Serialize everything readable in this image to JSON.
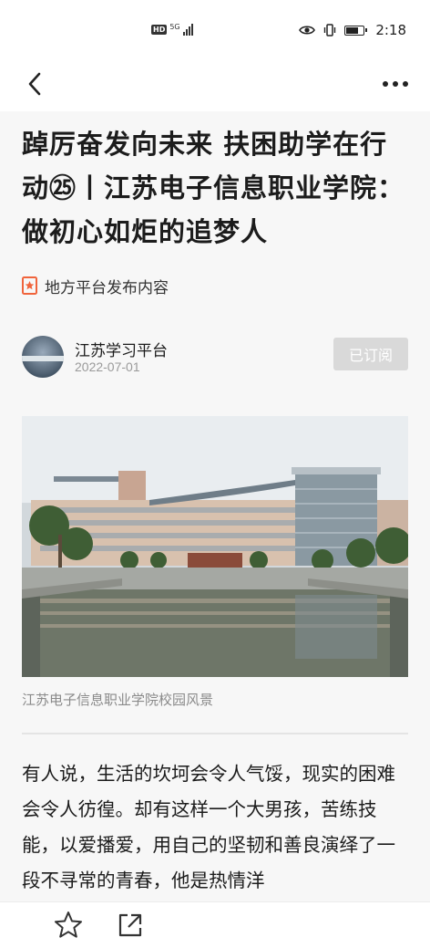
{
  "status_bar": {
    "network_badge": "HD",
    "network_type": "5G",
    "time": "2:18"
  },
  "nav": {
    "back_icon": "chevron-left-icon",
    "more_icon": "more-horizontal-icon"
  },
  "article": {
    "title": "踔厉奋发向未来 扶困助学在行动㉕丨江苏电子信息职业学院：做初心如炬的追梦人",
    "source_label": "地方平台发布内容",
    "author": {
      "name": "江苏学习平台",
      "date": "2022-07-01",
      "subscribe_label": "已订阅"
    },
    "image_caption": "江苏电子信息职业学院校园风景",
    "body": "有人说，生活的坎坷会令人气馁，现实的困难会令人彷徨。却有这样一个大男孩，苦练技能，以爱播爱，用自己的坚韧和善良演绎了一段不寻常的青春，他是热情洋"
  },
  "bottom_bar": {
    "favorite_icon": "star-icon",
    "share_icon": "share-icon"
  },
  "colors": {
    "source_badge": "#f0643c",
    "subscribed_bg": "#d9d9d9",
    "text": "#1c1c1c",
    "muted": "#9a9a9a"
  }
}
